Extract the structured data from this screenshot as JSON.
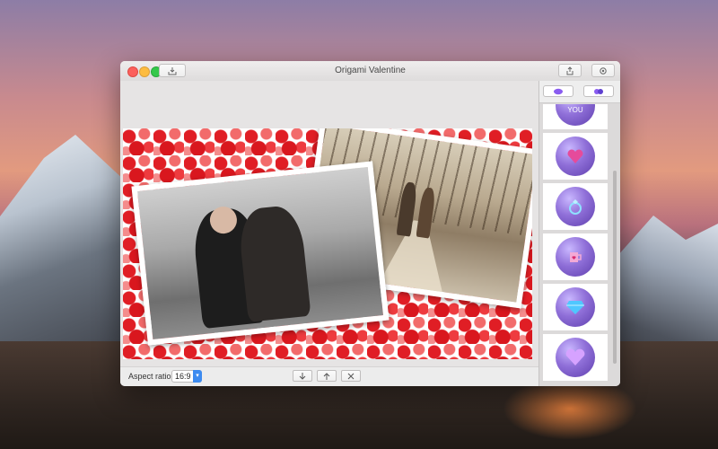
{
  "window": {
    "title": "Origami Valentine"
  },
  "toolbar": {
    "import_icon": "tray-arrow-down-icon",
    "share_icon": "share-icon",
    "settings_icon": "gear-icon"
  },
  "bottombar": {
    "aspect_label": "Aspect ratio:",
    "aspect_value": "16:9",
    "buttons": [
      "move-down-icon",
      "move-up-icon",
      "delete-icon"
    ]
  },
  "sidebar": {
    "tabs": [
      "stickers-tab",
      "effects-tab"
    ],
    "stickers": [
      {
        "text": "I LOVE YOU"
      },
      {
        "text": ""
      },
      {
        "text": ""
      },
      {
        "text": ""
      },
      {
        "text": ""
      },
      {
        "text": ""
      }
    ]
  },
  "colors": {
    "accent": "#3d8bf0",
    "heart_red": "#e01e25",
    "sticker_purple": "#8f6fd8"
  }
}
